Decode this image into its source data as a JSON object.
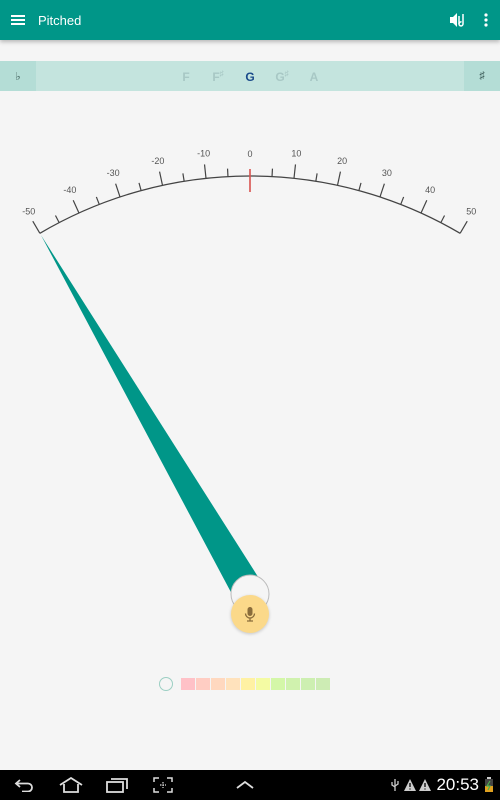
{
  "toolbar": {
    "title": "Pitched",
    "menu_icon": "hamburger-menu-icon",
    "sound_icon": "speaker-note-icon",
    "overflow_icon": "more-vert-icon",
    "background": "#009688"
  },
  "note_bar": {
    "flat_label": "♭",
    "sharp_label": "♯",
    "notes": [
      {
        "name": "F",
        "accidental": "",
        "selected": false
      },
      {
        "name": "F",
        "accidental": "♯",
        "selected": false
      },
      {
        "name": "G",
        "accidental": "",
        "selected": true
      },
      {
        "name": "G",
        "accidental": "♯",
        "selected": false
      },
      {
        "name": "A",
        "accidental": "",
        "selected": false
      }
    ]
  },
  "gauge": {
    "min_cents": -50,
    "max_cents": 50,
    "tick_labels": [
      "-50",
      "-40",
      "-30",
      "-20",
      "-10",
      "0",
      "10",
      "20",
      "30",
      "40",
      "50"
    ],
    "needle_cents": -50,
    "needle_color": "#009688",
    "center_marker_color": "#d9534f"
  },
  "mic_button": {
    "icon": "microphone-icon",
    "color": "#fbd98a"
  },
  "level_meter": {
    "segments": [
      "#ffc1c7",
      "#ffcdc3",
      "#ffd8bf",
      "#ffe2bc",
      "#fff1a3",
      "#f4fba3",
      "#d4f7a8",
      "#d0f2ae",
      "#cdefb1",
      "#cdecb4"
    ]
  },
  "system_bar": {
    "nav_icons": [
      "back-icon",
      "home-icon",
      "recent-apps-icon",
      "screenshot-icon",
      "up-chevron-icon"
    ],
    "status_icons": [
      "usb-icon",
      "warning-icon",
      "warning-icon"
    ],
    "time": "20:53",
    "battery_icon": "battery-charging-icon"
  }
}
